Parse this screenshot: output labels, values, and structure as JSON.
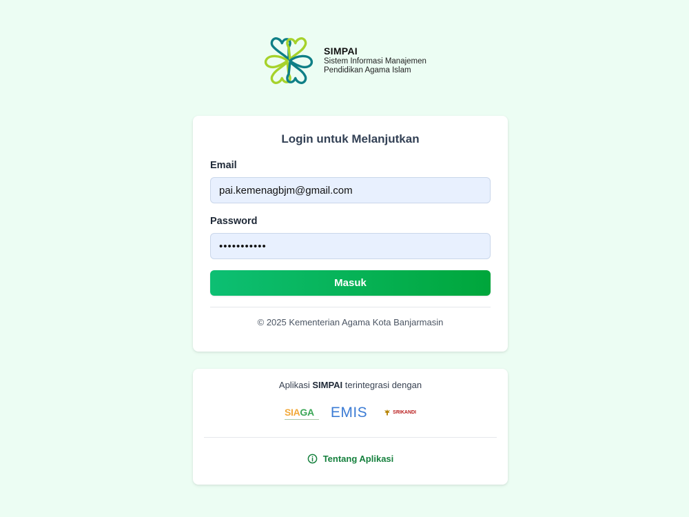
{
  "brand": {
    "name": "SIMPAI",
    "line1": "Sistem Informasi Manajemen",
    "line2": "Pendidikan Agama Islam",
    "logo_icon": "heart-clover-logo"
  },
  "login": {
    "title": "Login untuk Melanjutkan",
    "email_label": "Email",
    "email_value": "pai.kemenagbjm@gmail.com",
    "password_label": "Password",
    "password_value": "•••••••••••",
    "submit_label": "Masuk",
    "copyright": "© 2025 Kementerian Agama Kota Banjarmasin"
  },
  "integration": {
    "text_before": "Aplikasi",
    "app_name": "SIMPAI",
    "text_after": "terintegrasi dengan",
    "partners": {
      "siaga_part1": "SIA",
      "siaga_part2": "GA",
      "emis": "EMIS",
      "srikandi": "SRIKANDI"
    },
    "about_label": "Tentang Aplikasi",
    "about_icon": "info-icon"
  },
  "colors": {
    "background": "#ecfdf3",
    "primary_green": "#00a63b",
    "link_green": "#15803d",
    "input_bg": "#e8f0fe"
  }
}
